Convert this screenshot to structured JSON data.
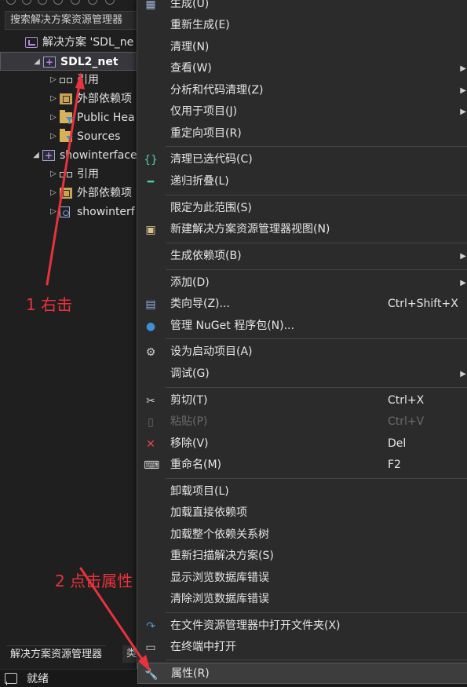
{
  "explorer": {
    "search_placeholder": "搜索解决方案资源管理器",
    "tree": [
      {
        "label": "解决方案 'SDL_ne",
        "icon": "solution-icon",
        "indent": 0,
        "expander": "",
        "selected": false
      },
      {
        "label": "SDL2_net",
        "icon": "cpp-project-icon",
        "indent": 1,
        "expander": "◢",
        "selected": true
      },
      {
        "label": "引用",
        "icon": "references-icon",
        "indent": 2,
        "expander": "▷",
        "selected": false
      },
      {
        "label": "外部依赖项",
        "icon": "external-deps-icon",
        "indent": 2,
        "expander": "▷",
        "selected": false
      },
      {
        "label": "Public Hea",
        "icon": "filter-folder-icon",
        "indent": 2,
        "expander": "▷",
        "selected": false
      },
      {
        "label": "Sources",
        "icon": "filter-folder-icon",
        "indent": 2,
        "expander": "▷",
        "selected": false
      },
      {
        "label": "showinterface",
        "icon": "cpp-project-icon",
        "indent": 1,
        "expander": "◢",
        "selected": false
      },
      {
        "label": "引用",
        "icon": "references-icon",
        "indent": 2,
        "expander": "▷",
        "selected": false
      },
      {
        "label": "外部依赖项",
        "icon": "external-deps-icon",
        "indent": 2,
        "expander": "▷",
        "selected": false
      },
      {
        "label": "showinterf",
        "icon": "cpp-file-icon",
        "indent": 2,
        "expander": "▷",
        "selected": false
      }
    ],
    "bottom_tabs": [
      {
        "label": "解决方案资源管理器",
        "active": true
      },
      {
        "label": "类",
        "active": false
      }
    ]
  },
  "statusbar": {
    "icon": "output-window-icon",
    "text": "就绪"
  },
  "menu": {
    "items": [
      {
        "label": "生成(U)",
        "shortcut": "",
        "submenu": false,
        "disabled": false,
        "icon": "build-icon",
        "sep_before": false
      },
      {
        "label": "重新生成(E)",
        "shortcut": "",
        "submenu": false,
        "disabled": false,
        "icon": "",
        "sep_before": false
      },
      {
        "label": "清理(N)",
        "shortcut": "",
        "submenu": false,
        "disabled": false,
        "icon": "",
        "sep_before": false
      },
      {
        "label": "查看(W)",
        "shortcut": "",
        "submenu": true,
        "disabled": false,
        "icon": "",
        "sep_before": false
      },
      {
        "label": "分析和代码清理(Z)",
        "shortcut": "",
        "submenu": true,
        "disabled": false,
        "icon": "",
        "sep_before": false
      },
      {
        "label": "仅用于项目(J)",
        "shortcut": "",
        "submenu": true,
        "disabled": false,
        "icon": "",
        "sep_before": false
      },
      {
        "label": "重定向项目(R)",
        "shortcut": "",
        "submenu": false,
        "disabled": false,
        "icon": "",
        "sep_before": false
      },
      {
        "label": "清理已选代码(C)",
        "shortcut": "",
        "submenu": false,
        "disabled": false,
        "icon": "braces-icon",
        "sep_before": true
      },
      {
        "label": "递归折叠(L)",
        "shortcut": "",
        "submenu": false,
        "disabled": false,
        "icon": "collapse-icon",
        "sep_before": false
      },
      {
        "label": "限定为此范围(S)",
        "shortcut": "",
        "submenu": false,
        "disabled": false,
        "icon": "",
        "sep_before": true
      },
      {
        "label": "新建解决方案资源管理器视图(N)",
        "shortcut": "",
        "submenu": false,
        "disabled": false,
        "icon": "new-view-icon",
        "sep_before": false
      },
      {
        "label": "生成依赖项(B)",
        "shortcut": "",
        "submenu": true,
        "disabled": false,
        "icon": "",
        "sep_before": true
      },
      {
        "label": "添加(D)",
        "shortcut": "",
        "submenu": true,
        "disabled": false,
        "icon": "",
        "sep_before": true
      },
      {
        "label": "类向导(Z)...",
        "shortcut": "Ctrl+Shift+X",
        "submenu": false,
        "disabled": false,
        "icon": "class-wizard-icon",
        "sep_before": false
      },
      {
        "label": "管理 NuGet 程序包(N)...",
        "shortcut": "",
        "submenu": false,
        "disabled": false,
        "icon": "nuget-icon",
        "sep_before": false
      },
      {
        "label": "设为启动项目(A)",
        "shortcut": "",
        "submenu": false,
        "disabled": false,
        "icon": "gear-icon",
        "sep_before": true
      },
      {
        "label": "调试(G)",
        "shortcut": "",
        "submenu": true,
        "disabled": false,
        "icon": "",
        "sep_before": false
      },
      {
        "label": "剪切(T)",
        "shortcut": "Ctrl+X",
        "submenu": false,
        "disabled": false,
        "icon": "scissors-icon",
        "sep_before": true
      },
      {
        "label": "粘贴(P)",
        "shortcut": "Ctrl+V",
        "submenu": false,
        "disabled": true,
        "icon": "paste-icon",
        "sep_before": false
      },
      {
        "label": "移除(V)",
        "shortcut": "Del",
        "submenu": false,
        "disabled": false,
        "icon": "remove-x-icon",
        "sep_before": false
      },
      {
        "label": "重命名(M)",
        "shortcut": "F2",
        "submenu": false,
        "disabled": false,
        "icon": "rename-icon",
        "sep_before": false
      },
      {
        "label": "卸载项目(L)",
        "shortcut": "",
        "submenu": false,
        "disabled": false,
        "icon": "",
        "sep_before": true
      },
      {
        "label": "加载直接依赖项",
        "shortcut": "",
        "submenu": false,
        "disabled": false,
        "icon": "",
        "sep_before": false
      },
      {
        "label": "加载整个依赖关系树",
        "shortcut": "",
        "submenu": false,
        "disabled": false,
        "icon": "",
        "sep_before": false
      },
      {
        "label": "重新扫描解决方案(S)",
        "shortcut": "",
        "submenu": false,
        "disabled": false,
        "icon": "",
        "sep_before": false
      },
      {
        "label": "显示浏览数据库错误",
        "shortcut": "",
        "submenu": false,
        "disabled": false,
        "icon": "",
        "sep_before": false
      },
      {
        "label": "清除浏览数据库错误",
        "shortcut": "",
        "submenu": false,
        "disabled": false,
        "icon": "",
        "sep_before": false
      },
      {
        "label": "在文件资源管理器中打开文件夹(X)",
        "shortcut": "",
        "submenu": false,
        "disabled": false,
        "icon": "open-folder-arrow-icon",
        "sep_before": true
      },
      {
        "label": "在终端中打开",
        "shortcut": "",
        "submenu": false,
        "disabled": false,
        "icon": "terminal-icon",
        "sep_before": false
      },
      {
        "label": "属性(R)",
        "shortcut": "",
        "submenu": false,
        "disabled": false,
        "icon": "wrench-icon",
        "sep_before": true,
        "highlight": true
      }
    ]
  },
  "annotations": {
    "step1": "1 右击",
    "step2": "2 点击属性",
    "color": "#e8323c"
  },
  "theme": {
    "menu_bg": "#2b2b2b",
    "explorer_bg": "#1f1f1f",
    "accent_purple": "#b48ad8"
  }
}
